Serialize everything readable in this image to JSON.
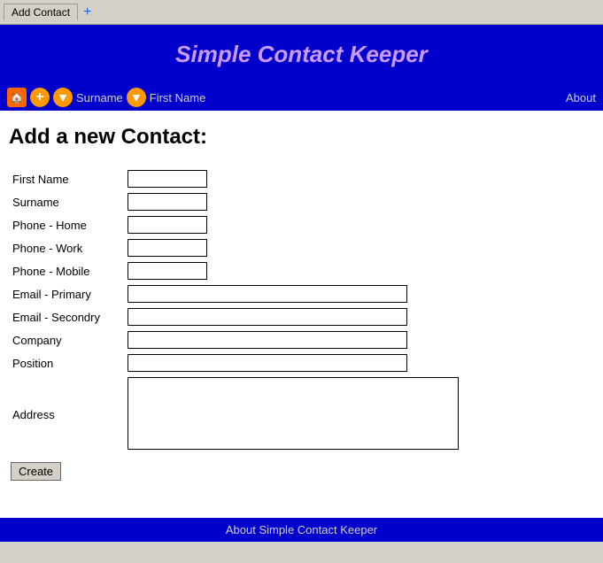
{
  "titlebar": {
    "tab_label": "Add Contact",
    "new_tab_icon": "+"
  },
  "header": {
    "title": "Simple Contact Keeper"
  },
  "navbar": {
    "home_icon": "🏠",
    "add_icon": "+",
    "down_icon1": "▼",
    "down_icon2": "▼",
    "surname_label": "Surname",
    "firstname_label": "First Name",
    "about_label": "About"
  },
  "page": {
    "title": "Add a new Contact:"
  },
  "form": {
    "fields": [
      {
        "label": "First Name",
        "type": "text",
        "size": "short"
      },
      {
        "label": "Surname",
        "type": "text",
        "size": "short"
      },
      {
        "label": "Phone - Home",
        "type": "text",
        "size": "short"
      },
      {
        "label": "Phone - Work",
        "type": "text",
        "size": "short"
      },
      {
        "label": "Phone - Mobile",
        "type": "text",
        "size": "short"
      },
      {
        "label": "Email - Primary",
        "type": "text",
        "size": "long"
      },
      {
        "label": "Email - Secondry",
        "type": "text",
        "size": "long"
      },
      {
        "label": "Company",
        "type": "text",
        "size": "long"
      },
      {
        "label": "Position",
        "type": "text",
        "size": "long"
      },
      {
        "label": "Address",
        "type": "textarea",
        "size": "long"
      }
    ],
    "create_button": "Create"
  },
  "footer": {
    "text": "About Simple Contact Keeper"
  }
}
